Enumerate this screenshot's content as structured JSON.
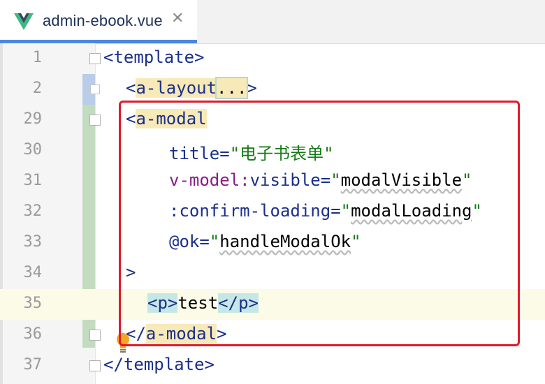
{
  "tab": {
    "filename": "admin-ebook.vue",
    "icon": "vue-logo-icon",
    "close_icon": "close-icon"
  },
  "colors": {
    "accent": "#4d87e0",
    "highlight_box": "#e21a2a",
    "tag": "#1a2f8a",
    "string": "#157a15",
    "directive": "#8a1a8a"
  },
  "lines": [
    {
      "num": "1",
      "t1": "<template>"
    },
    {
      "num": "2",
      "t0": "<",
      "t1": "a-layout",
      "t2": "...",
      "t3": ">"
    },
    {
      "num": "29",
      "t0": "<",
      "t1": "a-modal"
    },
    {
      "num": "30",
      "t1": "title=",
      "t2": "\"电子书表单\""
    },
    {
      "num": "31",
      "t1": "v-model:",
      "t2": "visible=",
      "t3": "\"",
      "t4": "modalVisible",
      "t5": "\""
    },
    {
      "num": "32",
      "t1": ":confirm-loading=",
      "t2": "\"",
      "t3": "modalLoading",
      "t4": "\""
    },
    {
      "num": "33",
      "t1": "@ok=",
      "t2": "\"",
      "t3": "handleModalOk",
      "t4": "\""
    },
    {
      "num": "34",
      "t1": ">"
    },
    {
      "num": "35",
      "t0": "<",
      "t1": "p",
      "t2": ">",
      "t3": "test",
      "t4": "</",
      "t5": "p",
      "t6": ">"
    },
    {
      "num": "36",
      "t0": "</",
      "t1": "a-modal",
      "t2": ">"
    },
    {
      "num": "37",
      "t1": "</template>"
    }
  ]
}
